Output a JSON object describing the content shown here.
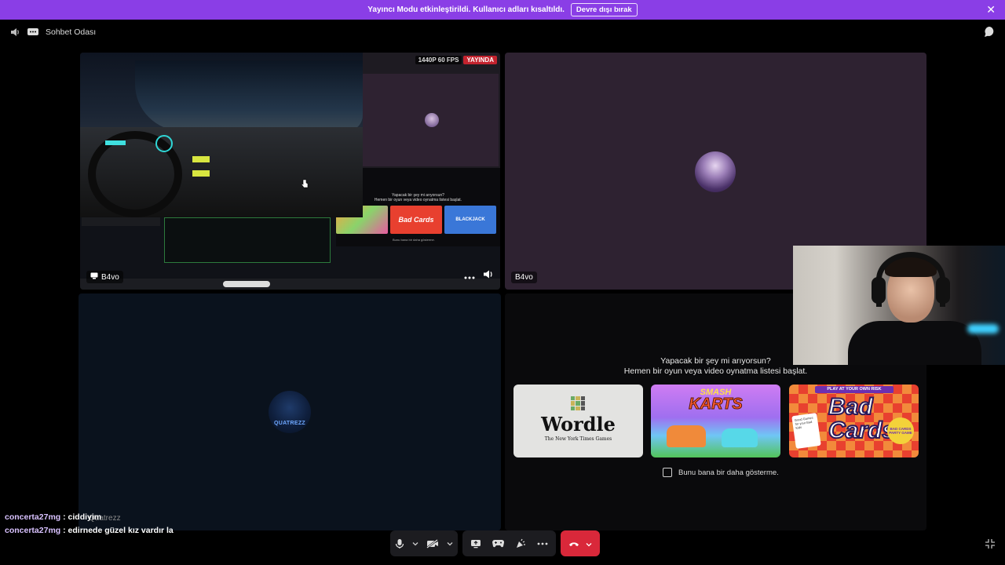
{
  "banner": {
    "message": "Yayıncı Modu etkinleştirildi. Kullanıcı adları kısaltıldı.",
    "disable_label": "Devre dışı bırak",
    "close_icon": "close-icon",
    "color": "#8a3ee6"
  },
  "channel": {
    "name": "Sohbet Odası"
  },
  "stream_tile": {
    "quality": "1440P 60 FPS",
    "live_label": "YAYINDA",
    "user": "B4vo",
    "live_color": "#c3232e",
    "inner_activity_line1": "Yapacak bir şey mi arıyorsun?",
    "inner_activity_line2": "Hemen bir oyun veya video oynatma listesi başlat.",
    "inner_checkbox": "Bunu bana bir daha gösterme.",
    "inner_card_blackjack": "BLACKJACK",
    "inner_card_bad": "Bad Cards"
  },
  "participant_tile": {
    "user": "B4vo"
  },
  "quatrezz_tile": {
    "avatar_text": "QUATREZZ",
    "user": "Quatrezz"
  },
  "activity": {
    "line1": "Yapacak bir şey mi arıyorsun?",
    "line2": "Hemen bir oyun veya video oynatma listesi başlat.",
    "games": [
      {
        "title": "Wordle",
        "subtitle": "The New York Times Games"
      },
      {
        "title_top": "SMASH",
        "title_bottom": "KARTS"
      },
      {
        "tag": "PLAY AT YOUR OWN RISK",
        "title_top": "Bad",
        "title_bottom": "Cards",
        "stamp": "BAD CARDS PARTY GAME",
        "card_text": "Good Games for your Bad Kids"
      }
    ],
    "dont_show_label": "Bunu bana bir daha gösterme."
  },
  "chat_overlay": [
    {
      "user": "concerta27mg",
      "message": "ciddiyim"
    },
    {
      "user": "concerta27mg",
      "message": "edirnede güzel kız vardır la"
    }
  ],
  "controls": {
    "icons": [
      "microphone-icon",
      "camera-off-icon",
      "screen-share-icon",
      "activity-icon",
      "soundboard-icon",
      "more-icon",
      "hang-up-icon"
    ],
    "hangup_color": "#d9283a"
  }
}
